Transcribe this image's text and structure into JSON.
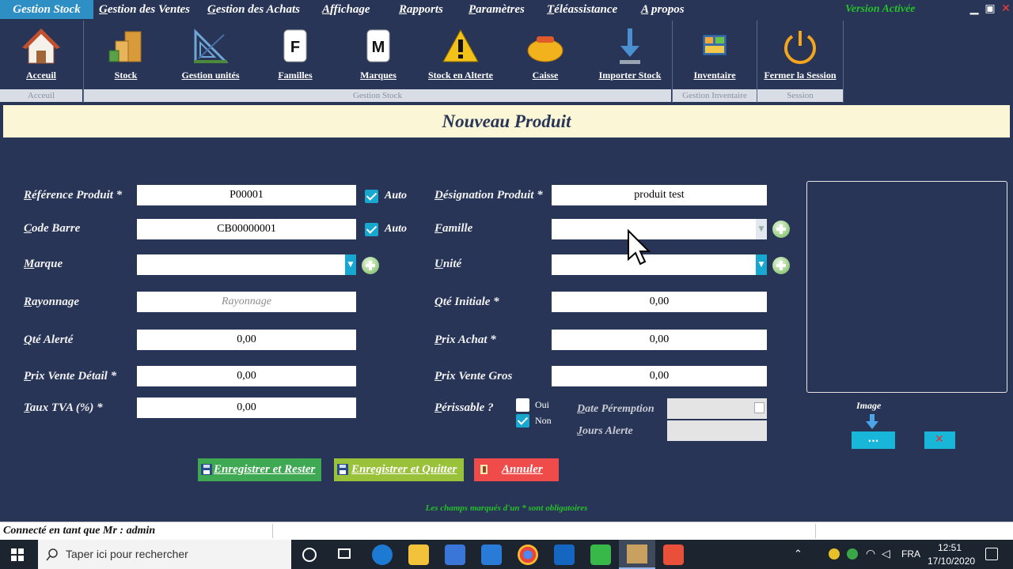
{
  "menubar": {
    "brand": "Gestion  Stock",
    "items": [
      "Gestion des Ventes",
      "Gestion des Achats",
      "Affichage",
      "Rapports",
      "Paramètres",
      "Téléassistance",
      "A propos"
    ],
    "version": "Version Activée"
  },
  "ribbon": {
    "buttons": [
      "Acceuil",
      "Stock",
      "Gestion unités",
      "Familles",
      "Marques",
      "Stock en Alterte",
      "Caisse",
      "Importer Stock",
      "Inventaire",
      "Fermer la Session"
    ],
    "groups": [
      "Acceuil",
      "Gestion Stock",
      "Gestion Inventaire",
      "Session"
    ],
    "icon_letters": {
      "familles": "F",
      "marques": "M"
    }
  },
  "form": {
    "title": "Nouveau Produit",
    "left": {
      "reference_label": "Référence Produit *",
      "reference_value": "P00001",
      "code_barre_label": "Code Barre",
      "code_barre_value": "CB00000001",
      "auto_label": "Auto",
      "marque_label": "Marque",
      "rayonnage_label": "Rayonnage",
      "rayonnage_placeholder": "Rayonnage",
      "qte_alerte_label": "Qté Alerté",
      "qte_alerte_value": "0,00",
      "prix_vente_detail_label": "Prix Vente Détail *",
      "prix_vente_detail_value": "0,00",
      "taux_tva_label": "Taux TVA (%) *",
      "taux_tva_value": "0,00"
    },
    "right": {
      "designation_label": "Désignation Produit *",
      "designation_value": "produit test",
      "famille_label": "Famille",
      "unite_label": "Unité",
      "qte_initiale_label": "Qté Initiale *",
      "qte_initiale_value": "0,00",
      "prix_achat_label": "Prix Achat *",
      "prix_achat_value": "0,00",
      "prix_vente_gros_label": "Prix Vente Gros",
      "prix_vente_gros_value": "0,00",
      "perissable_label": "Périssable ?",
      "oui_label": "Oui",
      "non_label": "Non",
      "date_peremption_label": "Date Péremption",
      "jours_alerte_label": "Jours Alerte"
    },
    "image_label": "Image",
    "image_browse": "...",
    "buttons": {
      "save_stay": "Enregistrer et Rester",
      "save_quit": "Enregistrer et Quitter",
      "cancel": "Annuler"
    },
    "required_note": "Les champs marqués d'un * sont obligatoires"
  },
  "statusbar": {
    "text": "Connecté en tant que Mr : admin"
  },
  "taskbar": {
    "search_placeholder": "Taper ici pour rechercher",
    "lang": "FRA",
    "time": "12:51",
    "date": "17/10/2020"
  },
  "colors": {
    "background": "#283556",
    "accent": "#18a7cf",
    "save_stay": "#3fa853",
    "save_quit": "#9ac13a",
    "cancel": "#ef4b4b",
    "version": "#25c02a"
  }
}
